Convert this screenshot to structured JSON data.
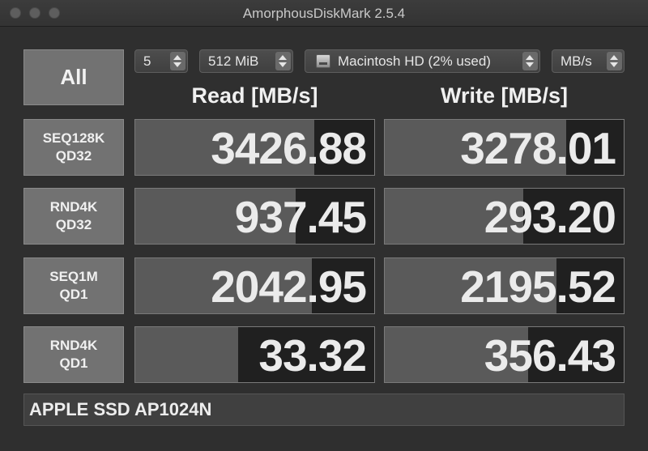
{
  "window": {
    "title": "AmorphousDiskMark 2.5.4"
  },
  "controls": {
    "all_label": "All",
    "count": "5",
    "size": "512 MiB",
    "disk": "Macintosh HD (2% used)",
    "unit": "MB/s"
  },
  "columns": {
    "read": "Read [MB/s]",
    "write": "Write [MB/s]"
  },
  "rows": [
    {
      "line1": "SEQ128K",
      "line2": "QD32",
      "read": "3426.88",
      "write": "3278.01",
      "read_fill": 0.75,
      "write_fill": 0.76
    },
    {
      "line1": "RND4K",
      "line2": "QD32",
      "read": "937.45",
      "write": "293.20",
      "read_fill": 0.67,
      "write_fill": 0.58
    },
    {
      "line1": "SEQ1M",
      "line2": "QD1",
      "read": "2042.95",
      "write": "2195.52",
      "read_fill": 0.74,
      "write_fill": 0.72
    },
    {
      "line1": "RND4K",
      "line2": "QD1",
      "read": "33.32",
      "write": "356.43",
      "read_fill": 0.43,
      "write_fill": 0.6
    }
  ],
  "device": {
    "name": "APPLE SSD AP1024N"
  },
  "colors": {
    "background": "#2f2f2f",
    "fill": "#5a5a5a",
    "cell": "#202020",
    "button": "#727272"
  }
}
